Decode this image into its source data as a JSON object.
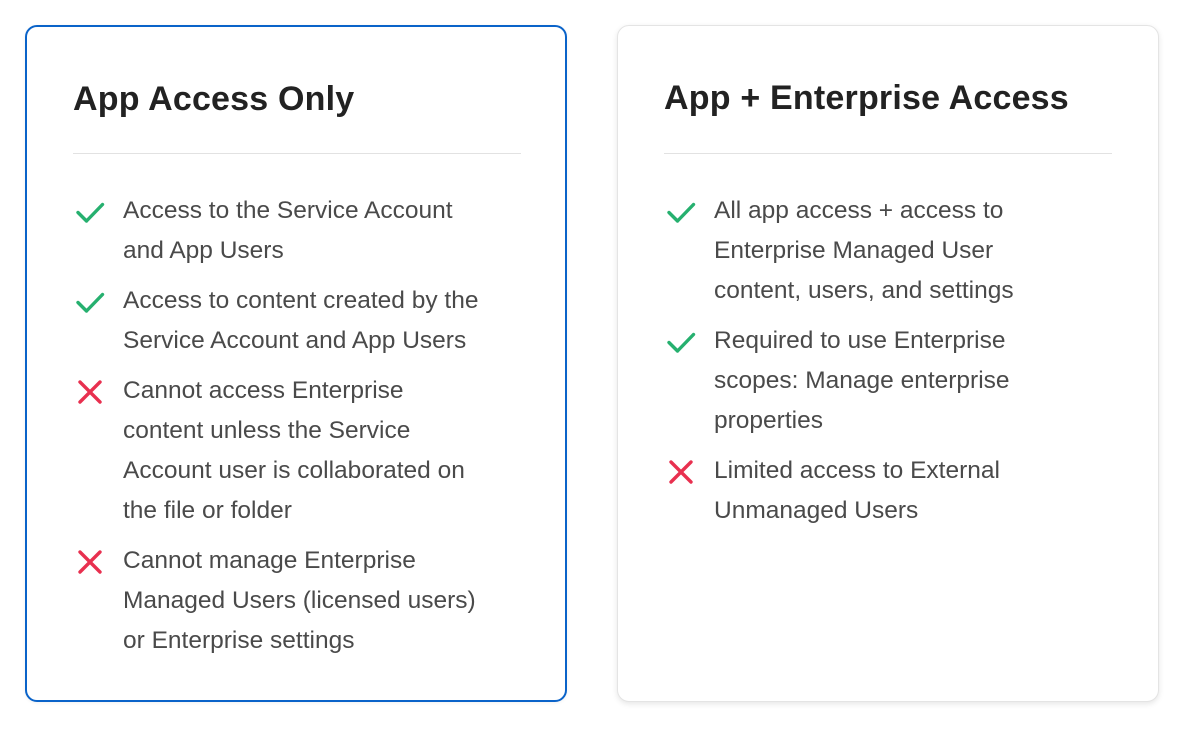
{
  "colors": {
    "check": "#26b06f",
    "cross": "#e8304f",
    "selected_border": "#0a63c9"
  },
  "cards": [
    {
      "title": "App Access Only",
      "selected": true,
      "features": [
        {
          "icon": "check-icon",
          "lines": [
            "Access to the Service Account",
            "and App Users"
          ]
        },
        {
          "icon": "check-icon",
          "lines": [
            "Access to content created by the",
            "Service Account and App Users"
          ]
        },
        {
          "icon": "cross-icon",
          "lines": [
            "Cannot access Enterprise",
            "content unless the Service",
            "Account user is collaborated on",
            "the file or folder"
          ]
        },
        {
          "icon": "cross-icon",
          "lines": [
            "Cannot manage Enterprise",
            "Managed Users (licensed users)",
            "or Enterprise settings"
          ]
        }
      ]
    },
    {
      "title": "App + Enterprise Access",
      "selected": false,
      "features": [
        {
          "icon": "check-icon",
          "lines": [
            "All app access + access to",
            "Enterprise Managed User",
            "content, users, and settings"
          ]
        },
        {
          "icon": "check-icon",
          "lines": [
            "Required to use Enterprise",
            "scopes: Manage enterprise",
            "properties"
          ]
        },
        {
          "icon": "cross-icon",
          "lines": [
            "Limited access to External",
            "Unmanaged Users"
          ]
        }
      ]
    }
  ]
}
